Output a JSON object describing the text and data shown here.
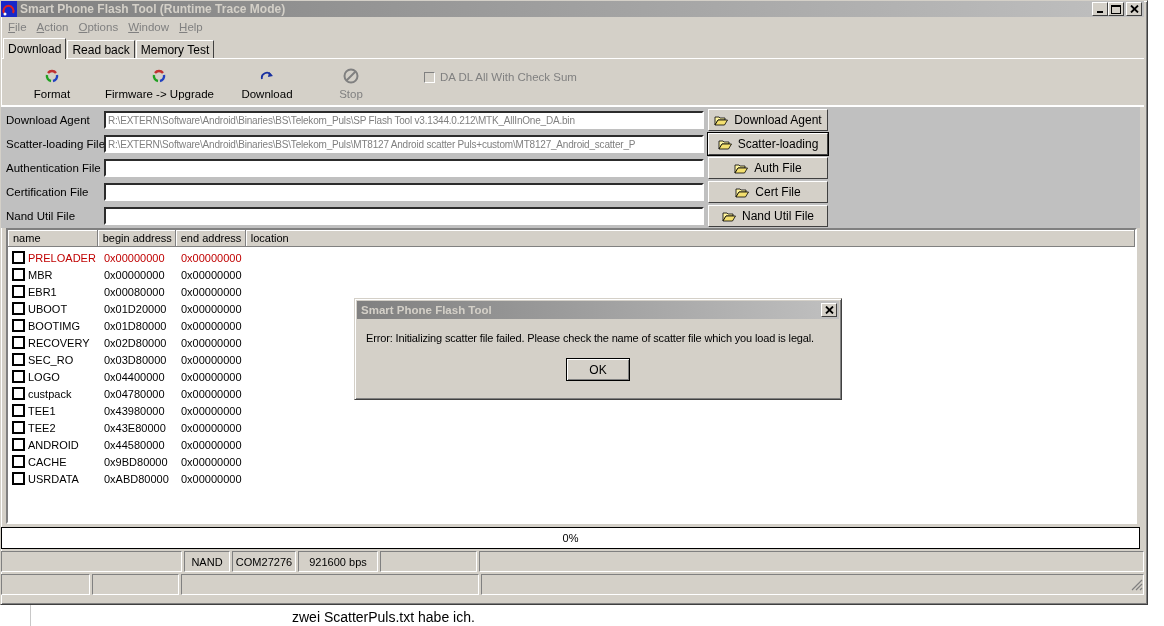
{
  "window": {
    "title": "Smart Phone Flash Tool (Runtime Trace Mode)",
    "active": false
  },
  "menu": [
    {
      "label": "File"
    },
    {
      "label": "Action"
    },
    {
      "label": "Options"
    },
    {
      "label": "Window"
    },
    {
      "label": "Help"
    }
  ],
  "tabs": [
    {
      "label": "Download",
      "selected": true
    },
    {
      "label": "Read back",
      "selected": false
    },
    {
      "label": "Memory Test",
      "selected": false
    }
  ],
  "toolbar": [
    {
      "label": "Format",
      "kind": "cycle",
      "disabled": false
    },
    {
      "label": "Firmware -> Upgrade",
      "kind": "cycle",
      "disabled": false
    },
    {
      "label": "Download",
      "kind": "arrow",
      "disabled": false
    },
    {
      "label": "Stop",
      "kind": "stop",
      "disabled": true
    }
  ],
  "checksum_option": {
    "label": "DA DL All With Check Sum",
    "checked": false,
    "disabled": true
  },
  "file_rows": [
    {
      "label": "Download Agent",
      "value": "R:\\EXTERN\\Software\\Android\\Binaries\\BS\\Telekom_Puls\\SP Flash Tool v3.1344.0.212\\MTK_AllInOne_DA.bin",
      "button": "Download Agent",
      "focused": false
    },
    {
      "label": "Scatter-loading File",
      "value": "R:\\EXTERN\\Software\\Android\\Binaries\\BS\\Telekom_Puls\\MT8127 Android scatter Puls+custom\\MT8127_Android_scatter_P",
      "button": "Scatter-loading",
      "focused": true
    },
    {
      "label": "Authentication File",
      "button": "Auth File",
      "focused": false
    },
    {
      "label": "Certification File",
      "button": "Cert File",
      "focused": false
    },
    {
      "label": "Nand Util File",
      "button": "Nand Util File",
      "focused": false
    }
  ],
  "partitions": {
    "columns": [
      "name",
      "begin address",
      "end address",
      "location"
    ],
    "rows": [
      {
        "name": "PRELOADER",
        "begin": "0x00000000",
        "end": "0x00000000",
        "checked": false,
        "color": "#c00000"
      },
      {
        "name": "MBR",
        "begin": "0x00000000",
        "end": "0x00000000",
        "checked": false,
        "color": "#000000"
      },
      {
        "name": "EBR1",
        "begin": "0x00080000",
        "end": "0x00000000",
        "checked": false,
        "color": "#000000"
      },
      {
        "name": "UBOOT",
        "begin": "0x01D20000",
        "end": "0x00000000",
        "checked": false,
        "color": "#000000"
      },
      {
        "name": "BOOTIMG",
        "begin": "0x01D80000",
        "end": "0x00000000",
        "checked": false,
        "color": "#000000"
      },
      {
        "name": "RECOVERY",
        "begin": "0x02D80000",
        "end": "0x00000000",
        "checked": false,
        "color": "#000000"
      },
      {
        "name": "SEC_RO",
        "begin": "0x03D80000",
        "end": "0x00000000",
        "checked": false,
        "color": "#000000"
      },
      {
        "name": "LOGO",
        "begin": "0x04400000",
        "end": "0x00000000",
        "checked": false,
        "color": "#000000"
      },
      {
        "name": "custpack",
        "begin": "0x04780000",
        "end": "0x00000000",
        "checked": false,
        "color": "#000000"
      },
      {
        "name": "TEE1",
        "begin": "0x43980000",
        "end": "0x00000000",
        "checked": false,
        "color": "#000000"
      },
      {
        "name": "TEE2",
        "begin": "0x43E80000",
        "end": "0x00000000",
        "checked": false,
        "color": "#000000"
      },
      {
        "name": "ANDROID",
        "begin": "0x44580000",
        "end": "0x00000000",
        "checked": false,
        "color": "#000000"
      },
      {
        "name": "CACHE",
        "begin": "0x9BD80000",
        "end": "0x00000000",
        "checked": false,
        "color": "#000000"
      },
      {
        "name": "USRDATA",
        "begin": "0xABD80000",
        "end": "0x00000000",
        "checked": false,
        "color": "#000000"
      }
    ]
  },
  "progress": {
    "label": "0%",
    "level": 0
  },
  "status_bar": {
    "cells": [
      "NAND",
      "COM27276",
      "921600 bps"
    ]
  },
  "dialog": {
    "title": "Smart Phone Flash Tool",
    "message": "Error: Initializing scatter file failed. Please check the name of scatter file which you load is legal.",
    "button": "OK"
  },
  "page_text": "zwei ScatterPuls.txt habe ich."
}
